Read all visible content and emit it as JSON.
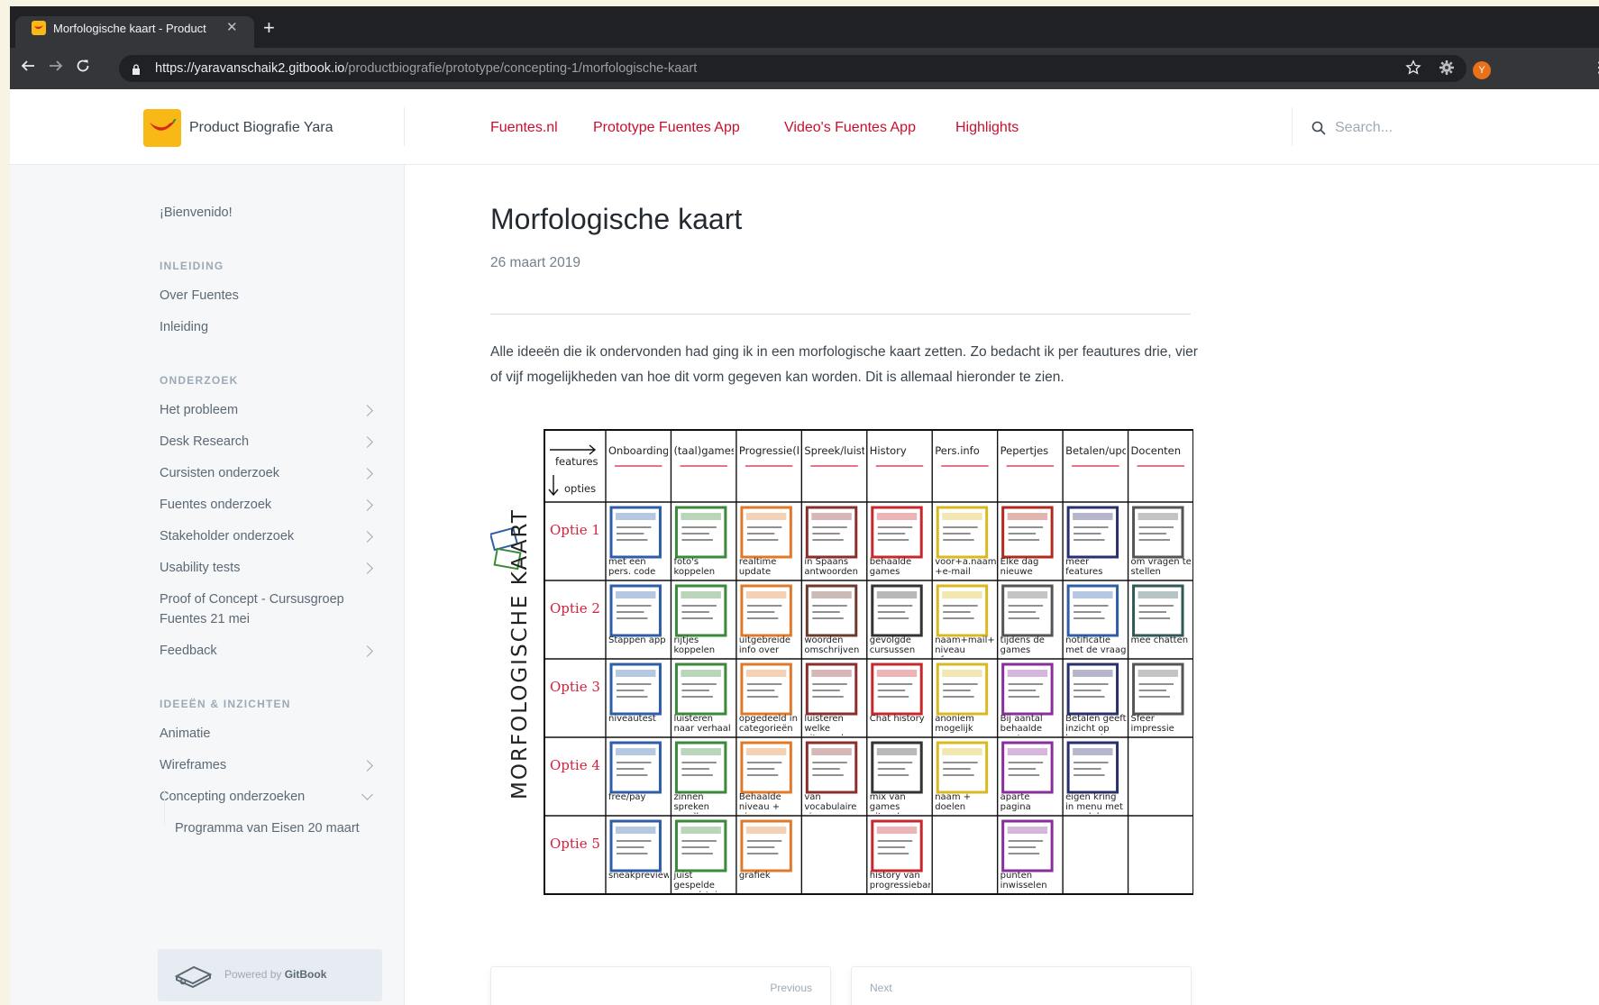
{
  "browser": {
    "tab_title": "Morfologische kaart - Product",
    "url_host": "https://yaravanschaik2.gitbook.io",
    "url_path": "/productbiografie/prototype/concepting-1/morfologische-kaart",
    "profile_initial": "Y"
  },
  "header": {
    "site_title": "Product Biografie Yara",
    "nav": [
      "Fuentes.nl",
      "Prototype Fuentes App",
      "Video's Fuentes App",
      "Highlights"
    ],
    "search_placeholder": "Search..."
  },
  "sidebar": {
    "welcome": "¡Bienvenido!",
    "sections": [
      {
        "title": "INLEIDING",
        "items": [
          "Over Fuentes",
          "Inleiding"
        ]
      },
      {
        "title": "ONDERZOEK",
        "items": [
          "Het probleem",
          "Desk Research",
          "Cursisten onderzoek",
          "Fuentes onderzoek",
          "Stakeholder onderzoek",
          "Usability tests",
          "Proof of Concept - Cursusgroep",
          "Fuentes 21 mei",
          "Feedback"
        ]
      },
      {
        "title": "IDEEËN & INZICHTEN",
        "items": [
          "Animatie",
          "Wireframes",
          "Concepting onderzoeken"
        ]
      }
    ],
    "sub_item": "Programma van Eisen 20 maart",
    "powered_prefix": "Powered by ",
    "powered_brand": "GitBook"
  },
  "page": {
    "title": "Morfologische kaart",
    "date": "26 maart 2019",
    "intro": "Alle ideeën die ik ondervonden had ging ik in een morfologische kaart zetten. Zo bedacht ik per feautures drie, vier of vijf mogelijkheden van hoe dit vorm gegeven kan worden. Dit is allemaal hieronder te zien."
  },
  "map": {
    "side_label": "MORFOLOGISCHE KAART",
    "corner_top": "features",
    "corner_bottom": "opties",
    "columns": [
      "Onboarding",
      "(taal)games",
      "Progressie(bar)",
      "Spreek/luister",
      "History",
      "Pers.info",
      "Pepertjes",
      "Betalen/update",
      "Docenten"
    ],
    "rows": [
      "Optie 1",
      "Optie 2",
      "Optie 3",
      "Optie 4",
      "Optie 5"
    ],
    "captions": [
      [
        "met een pers. code",
        "foto's koppelen",
        "realtime update",
        "in Spaans antwoorden",
        "behaalde games",
        "voor+a.naam +e-mail",
        "Elke dag nieuwe",
        "meer features",
        "om vragen te stellen"
      ],
      [
        "Stappen app",
        "rijtjes koppelen",
        "uitgebreide info over progr.",
        "woorden omschrijven",
        "gevolgde cursussen",
        "naam+mail+ niveau afg.cursus, doelen, free/pay",
        "tijdens de games",
        "notificatie met de vraag",
        "mee chatten"
      ],
      [
        "niveautest",
        "luisteren naar verhaal + vragen",
        "opgedeeld in categorieën",
        "luisteren welke uitspraak goed",
        "Chat history",
        "anoniem mogelijk",
        "Bij aantal behaalde punten",
        "Betalen geeft inzicht op hoger niveau",
        "Sfeer impressie"
      ],
      [
        "free/pay",
        "zinnen spreken goedkeuren door jezelf",
        "Behaalde niveau + niveau au hoger",
        "van vocabulaire zinnen maken",
        "mix van games uitzoeken chats",
        "naam + doelen",
        "aparte pagina",
        "eigen kring in menu met voordelen",
        ""
      ],
      [
        "sneakpreview",
        "juist gespelde woord / zin",
        "grafiek",
        "",
        "history van progressiebar",
        "",
        "punten inwisselen voor pepertjes",
        "",
        ""
      ]
    ],
    "cell_colors": [
      [
        "#2f5ea8",
        "#3a8a3a",
        "#e07a2a",
        "#8a2e2e",
        "#c8272d",
        "#d9b820",
        "#b3281f",
        "#2a2f6e",
        "#555555"
      ],
      [
        "#2f5ea8",
        "#3a8a3a",
        "#e07a2a",
        "#6b3a2a",
        "#333333",
        "#d9b820",
        "#555555",
        "#2f5ea8",
        "#2f5a55"
      ],
      [
        "#2f5ea8",
        "#3a8a3a",
        "#e07a2a",
        "#8a2e2e",
        "#c8272d",
        "#d9b820",
        "#8a2e9e",
        "#2a2f6e",
        "#555555"
      ],
      [
        "#2f5ea8",
        "#3a8a3a",
        "#e07a2a",
        "#8a2e2e",
        "#333333",
        "#d9b820",
        "#8a2e9e",
        "#2a2f6e",
        ""
      ],
      [
        "#2f5ea8",
        "#3a8a3a",
        "#e07a2a",
        "",
        "#c8272d",
        "",
        "#8a2e9e",
        "",
        ""
      ]
    ]
  },
  "pager": {
    "prev": "Previous",
    "next": "Next"
  }
}
